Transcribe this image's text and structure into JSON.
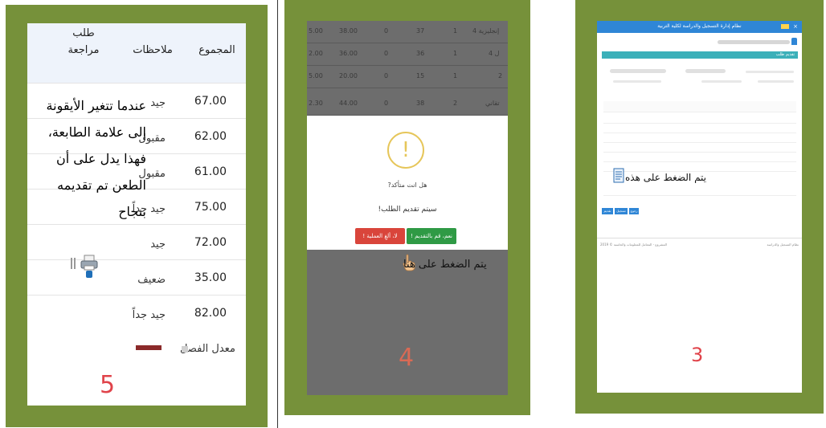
{
  "panel5": {
    "header": {
      "col_total": "المجموع",
      "col_notes": "ملاحظات",
      "col_review": "طلب مراجعة"
    },
    "rows": [
      {
        "total": "67.00",
        "note": "جيد"
      },
      {
        "total": "62.00",
        "note": "مقبول"
      },
      {
        "total": "61.00",
        "note": "مقبول"
      },
      {
        "total": "75.00",
        "note": "جيد جداً"
      },
      {
        "total": "72.00",
        "note": "جيد"
      },
      {
        "total": "35.00",
        "note": "ضعيف"
      },
      {
        "total": "82.00",
        "note": "جيد جداً"
      }
    ],
    "callout": "عندما تتغير الأيقونة إلى علامة الطابعة، فهذا يدل على أن الطعن تم تقديمه بنجاح",
    "average_label": "معدل الفصل",
    "step_number": "5"
  },
  "panel4": {
    "grid_rows": [
      {
        "a": "5.00",
        "b": "38.00",
        "c": "0",
        "d": "37",
        "e": "1",
        "f": "إنجليزية 4"
      },
      {
        "a": "2.00",
        "b": "36.00",
        "c": "0",
        "d": "36",
        "e": "1",
        "f": "ل 4"
      },
      {
        "a": "5.00",
        "b": "20.00",
        "c": "0",
        "d": "15",
        "e": "1",
        "f": "2"
      },
      {
        "a": "2.30",
        "b": "44.00",
        "c": "0",
        "d": "38",
        "e": "2",
        "f": "تقاني"
      }
    ],
    "dialog": {
      "icon": "!",
      "question": "?هل انت متأكد",
      "message": "!سيتم تقديم الطلب",
      "confirm_label": "! نعم، قم بالتقديم",
      "cancel_label": "! لا، ألغِ العملية"
    },
    "hint": "يتم الضغط على هنا",
    "step_number": "4"
  },
  "panel3": {
    "title": "نظام إدارة التسجيل والدراسة لكلية التربية",
    "section_title": "تقديم طلب",
    "hint": "يتم الضغط على هذه",
    "buttons": {
      "submit": "تقديم",
      "save": "تسجيل",
      "back": "رجوع"
    },
    "footer_right": "نظام التسجيل والدراسة",
    "footer_left": "المشروع - المعامل للمعلومات والحاسبة © 2019",
    "step_number": "3"
  },
  "colors": {
    "frame": "#76913a",
    "accent_red": "#e0434a",
    "confirm_green": "#2f9a45",
    "cancel_red": "#d9453b",
    "topbar_blue": "#2f86d6",
    "section_teal": "#3bb0b9"
  }
}
